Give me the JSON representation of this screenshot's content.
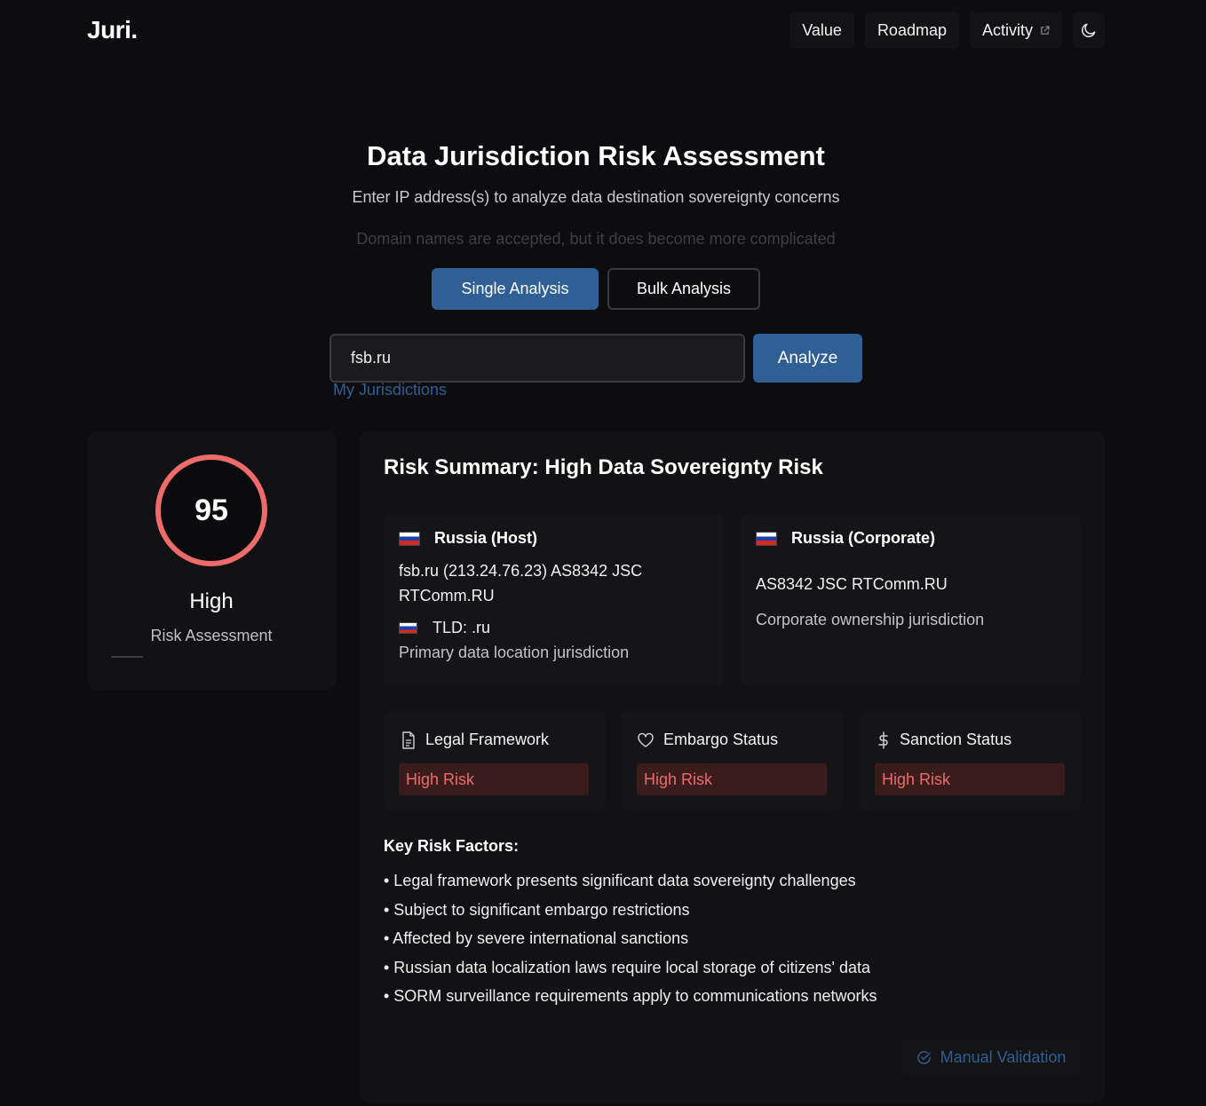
{
  "header": {
    "logo": "Juri.",
    "nav": [
      {
        "label": "Value"
      },
      {
        "label": "Roadmap"
      },
      {
        "label": "Activity",
        "icon": "external-link-icon"
      }
    ],
    "theme_icon": "moon-icon"
  },
  "hero": {
    "title": "Data Jurisdiction Risk Assessment",
    "subtitle": "Enter IP address(s) to analyze data destination sovereignty concerns",
    "note": "Domain names are accepted, but it does become more complicated"
  },
  "tabs": {
    "single": "Single Analysis",
    "bulk": "Bulk Analysis",
    "active": "single"
  },
  "search": {
    "value": "fsb.ru",
    "button": "Analyze",
    "link": "My Jurisdictions"
  },
  "score": {
    "value": "95",
    "level": "High",
    "caption": "Risk Assessment",
    "color": "#ee6b6b"
  },
  "summary": {
    "title": "Risk Summary: High Data Sovereignty Risk",
    "host": {
      "title": "Russia (Host)",
      "detail": "fsb.ru (213.24.76.23) AS8342 JSC RTComm.RU",
      "tld": "TLD: .ru",
      "note": "Primary data location jurisdiction"
    },
    "corporate": {
      "title": "Russia (Corporate)",
      "detail": "AS8342 JSC RTComm.RU",
      "note": "Corporate ownership jurisdiction"
    },
    "risks": [
      {
        "label": "Legal Framework",
        "status": "High Risk",
        "icon": "document-icon"
      },
      {
        "label": "Embargo Status",
        "status": "High Risk",
        "icon": "heart-icon"
      },
      {
        "label": "Sanction Status",
        "status": "High Risk",
        "icon": "dollar-icon"
      }
    ],
    "key_factors_title": "Key Risk Factors:",
    "key_factors": [
      "• Legal framework presents significant data sovereignty challenges",
      "• Subject to significant embargo restrictions",
      "• Affected by severe international sanctions",
      "• Russian data localization laws require local storage of citizens' data",
      "• SORM surveillance requirements apply to communications networks"
    ],
    "manual_validation": "Manual Validation"
  },
  "colors": {
    "accent": "#2f5f94",
    "danger": "#ee6b6b",
    "background": "#0d0d10"
  }
}
